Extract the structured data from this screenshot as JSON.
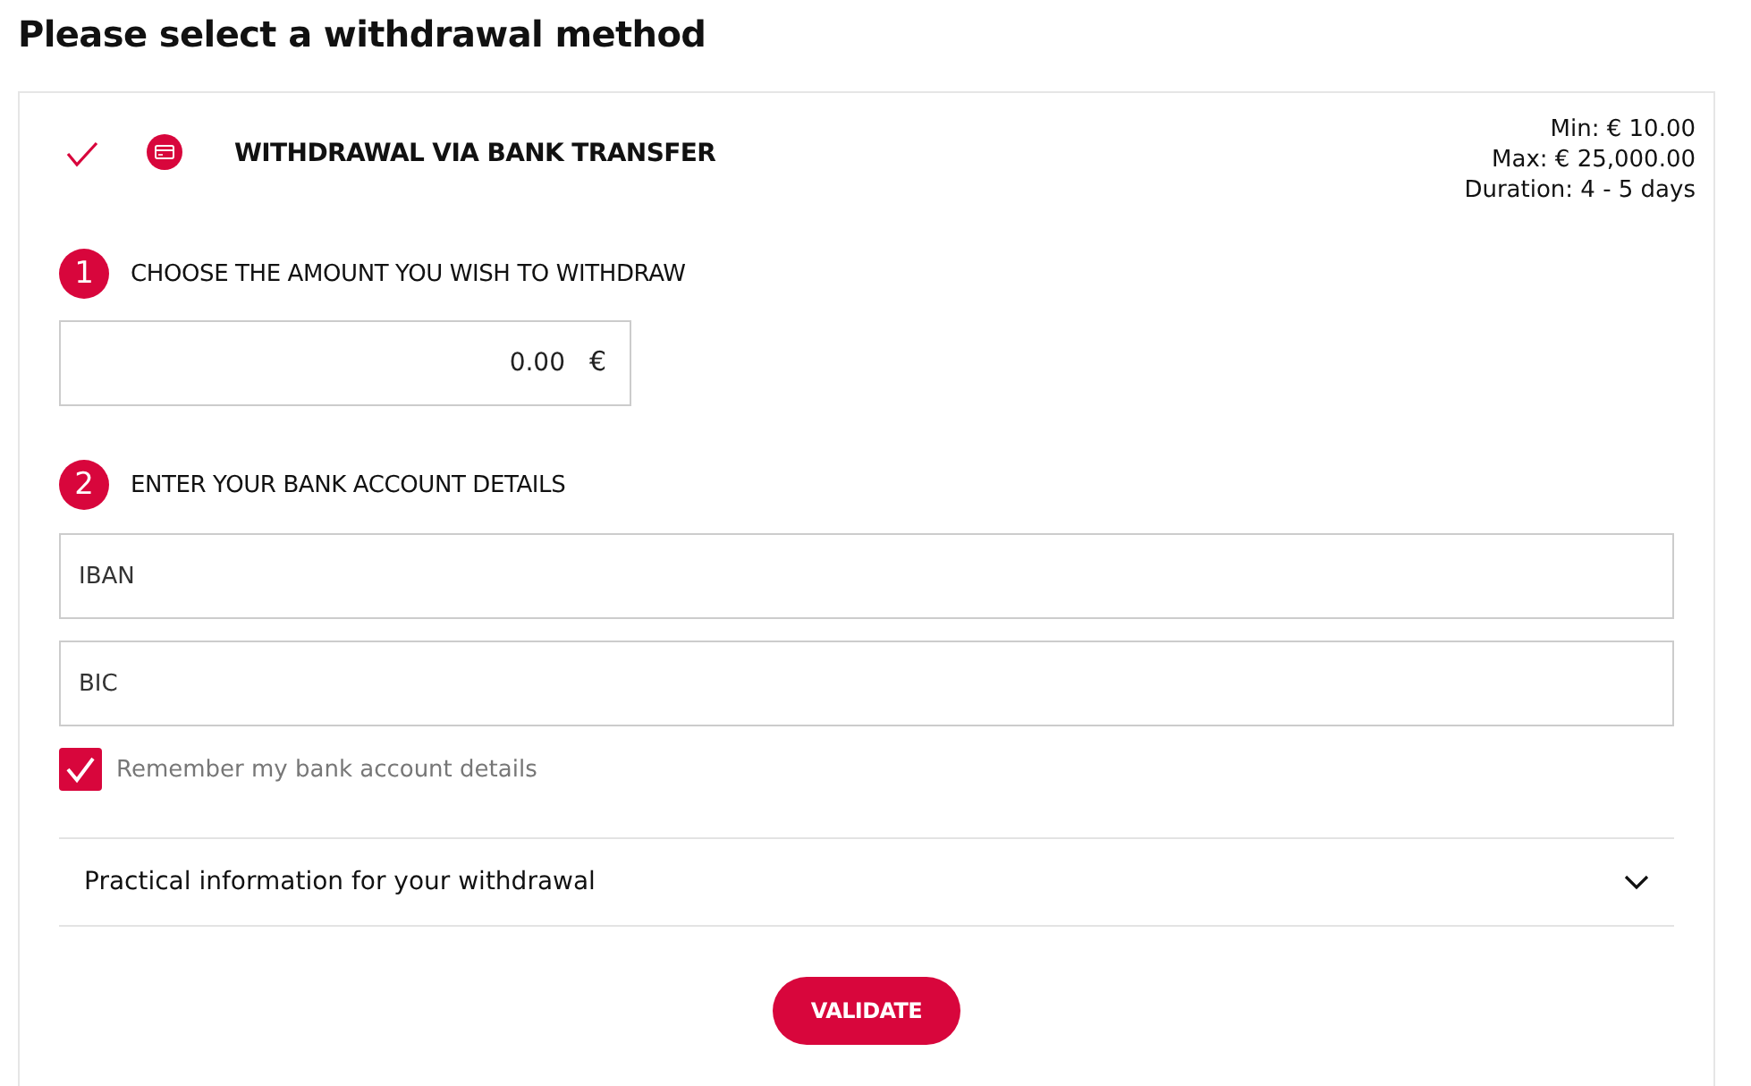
{
  "page_title": "Please select a withdrawal method",
  "method": {
    "title": "WITHDRAWAL VIA BANK TRANSFER",
    "selected": true,
    "limits": [
      "Min: € 10.00",
      "Max: € 25,000.00",
      "Duration: 4 - 5 days"
    ]
  },
  "steps": [
    {
      "number": "1",
      "label": "CHOOSE THE AMOUNT YOU WISH TO WITHDRAW"
    },
    {
      "number": "2",
      "label": "ENTER YOUR BANK ACCOUNT DETAILS"
    }
  ],
  "amount": {
    "value": "0.00",
    "currency": "€"
  },
  "fields": [
    {
      "placeholder": "IBAN"
    },
    {
      "placeholder": "BIC"
    }
  ],
  "remember": {
    "label": "Remember my bank account details",
    "checked": true
  },
  "info": {
    "label": "Practical information for your withdrawal",
    "expanded": false
  },
  "button": "VALIDATE"
}
